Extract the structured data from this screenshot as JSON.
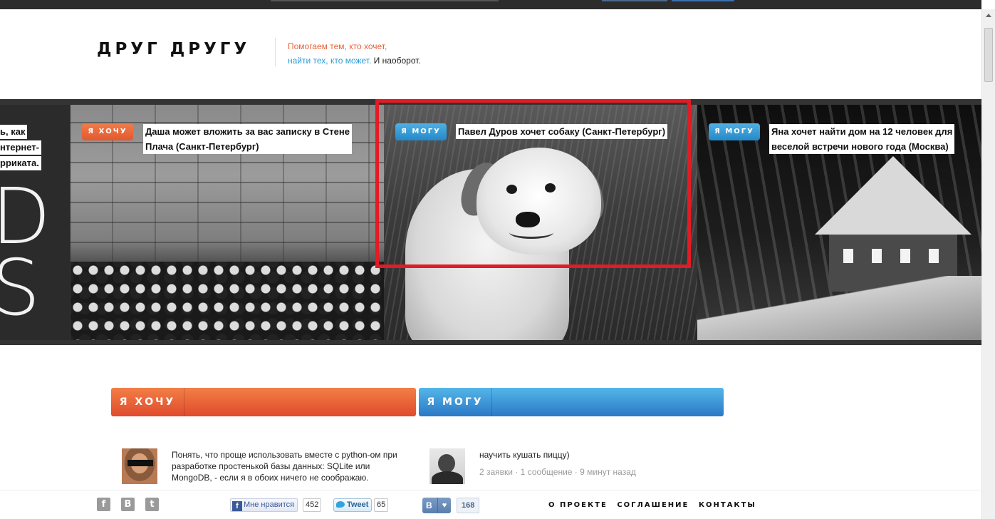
{
  "header": {
    "logo": "ДРУГ ДРУГУ",
    "tagline_orange": "Помогаем тем, кто хочет,",
    "tagline_blue": "найти тех, кто может.",
    "tagline_dark": "И наоборот."
  },
  "carousel": {
    "left_partial": {
      "line1": "ь, как",
      "line2": "нтернет-",
      "line3": "рриката.",
      "big_text": "D\nS"
    },
    "slides": [
      {
        "badge": "Я ХОЧУ",
        "caption_line1": "Даша может вложить за вас записку в Стене",
        "caption_line2": "Плача (Санкт-Петербург)",
        "image": "western-wall-photo"
      },
      {
        "badge": "Я МОГУ",
        "caption_line1": "Павел Дуров хочет собаку (Санкт-Петербург)",
        "caption_line2": "",
        "image": "smiling-dog-photo"
      },
      {
        "badge": "Я МОГУ",
        "caption_line1": "Яна хочет найти дом на 12 человек для",
        "caption_line2": "веселой встречи нового года (Москва)",
        "image": "snowy-house-photo"
      }
    ],
    "highlight_color": "#e21b24"
  },
  "tabs": {
    "want": "Я ХОЧУ",
    "can": "Я МОГУ"
  },
  "posts": {
    "left": {
      "text": "Понять, что проще использовать вместе с python-ом при разработке простенькой базы данных: SQLite или MongoDB, - если я в обоих ничего не соображаю."
    },
    "right": {
      "text": "научить кушать пиццу)",
      "meta": "2 заявки · 1 сообщение · 9 минут назад"
    }
  },
  "footer": {
    "social_icons": [
      "facebook-icon",
      "vk-icon",
      "twitter-icon"
    ],
    "fb_like": "Мне нравится",
    "fb_count": "452",
    "tweet": "Tweet",
    "tweet_count": "65",
    "vk_label": "В",
    "vk_count": "168",
    "links": [
      "О ПРОЕКТЕ",
      "СОГЛАШЕНИЕ",
      "КОНТАКТЫ"
    ]
  },
  "colors": {
    "want": "#e2582f",
    "can": "#2589c8"
  }
}
